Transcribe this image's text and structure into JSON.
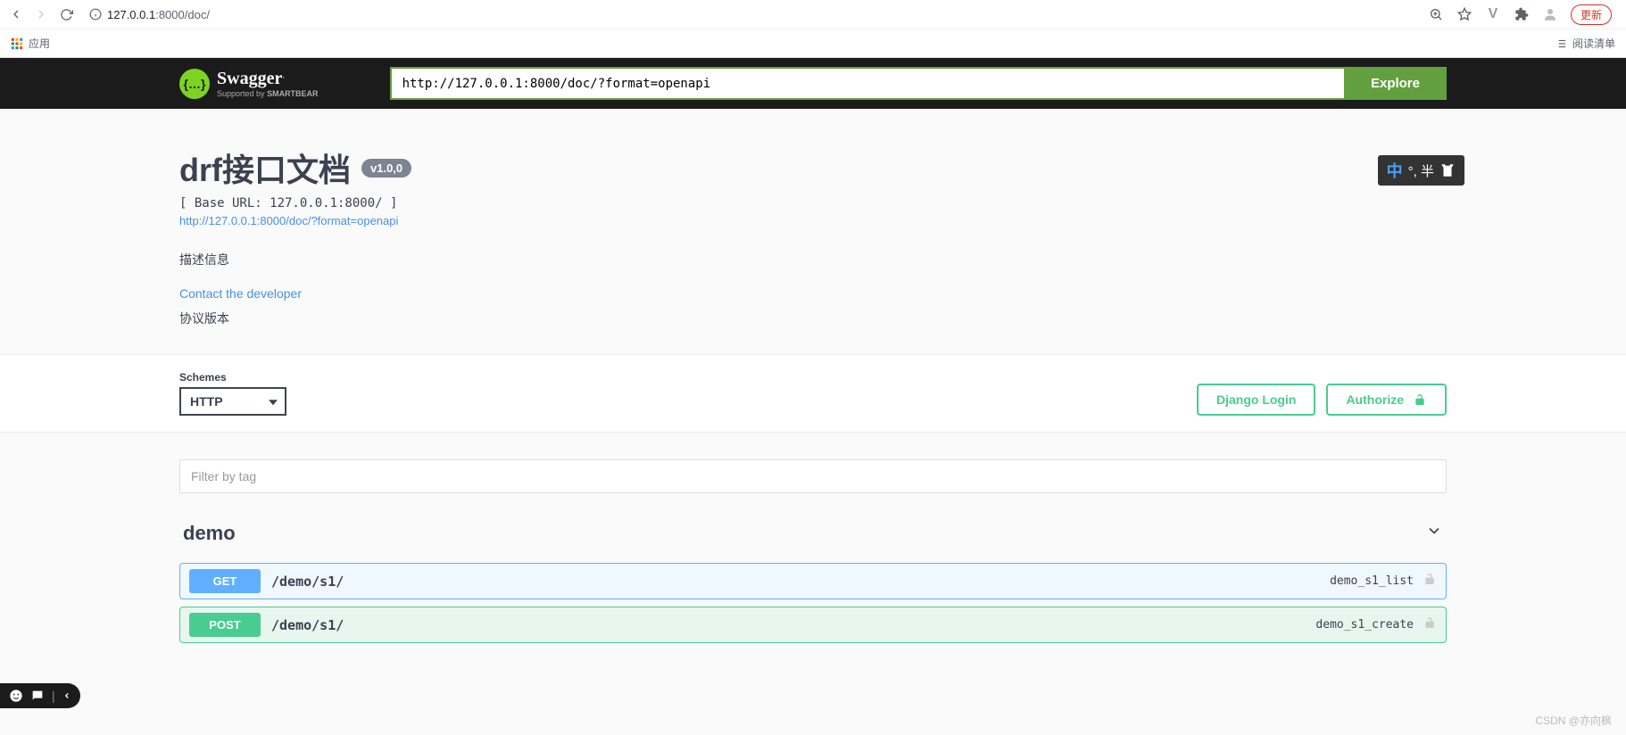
{
  "browser": {
    "url_display_host": "127.0.0.1",
    "url_display_port_path": ":8000/doc/",
    "apps_label": "应用",
    "reading_list": "阅读清单",
    "update_label": "更新"
  },
  "topbar": {
    "logo_main": "Swagger",
    "logo_supported": "Supported by",
    "logo_brand": "SMARTBEAR",
    "url_value": "http://127.0.0.1:8000/doc/?format=openapi",
    "explore_label": "Explore"
  },
  "info": {
    "title": "drf接口文档",
    "version": "v1.0,0",
    "base_url_label": "[ Base URL: 127.0.0.1:8000/ ]",
    "spec_link": "http://127.0.0.1:8000/doc/?format=openapi",
    "description": "描述信息",
    "contact_label": "Contact the developer",
    "tos_label": "协议版本"
  },
  "ime": {
    "text": "°, 半"
  },
  "schemes": {
    "label": "Schemes",
    "selected": "HTTP"
  },
  "auth": {
    "login_label": "Django Login",
    "authorize_label": "Authorize"
  },
  "filter": {
    "placeholder": "Filter by tag"
  },
  "tags": [
    {
      "name": "demo"
    }
  ],
  "operations": [
    {
      "method": "GET",
      "path": "/demo/s1/",
      "op_id": "demo_s1_list"
    },
    {
      "method": "POST",
      "path": "/demo/s1/",
      "op_id": "demo_s1_create"
    }
  ],
  "watermark": "CSDN @亦向枫"
}
